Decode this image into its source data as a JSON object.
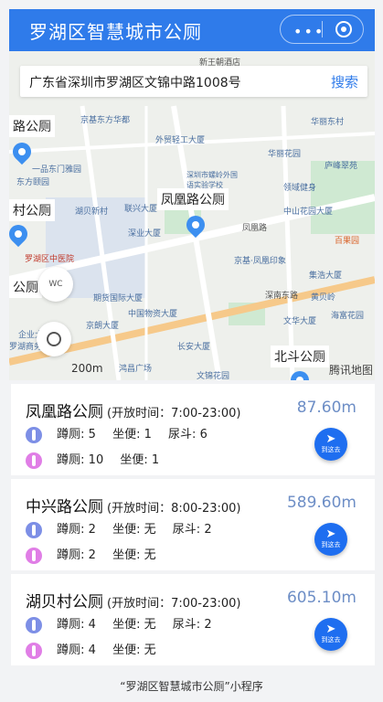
{
  "header": {
    "title": "罗湖区智慧城市公厕"
  },
  "search": {
    "value": "广东省深圳市罗湖区文锦中路1008号",
    "button": "搜索"
  },
  "map": {
    "callouts": [
      "路公厕",
      "凤凰路公厕",
      "村公厕",
      "公厕",
      "北斗公厕"
    ],
    "pois": [
      "新王朝酒店",
      "京基东方华都",
      "外贸轻工大厦",
      "华丽东村",
      "华丽花园",
      "庐峰翠苑",
      "一品东门雅园",
      "东方颐园",
      "深圳市螺岭外国语实验学校",
      "领域健身",
      "湖贝新村",
      "联兴大厦",
      "深业大厦",
      "中山花园大厦",
      "百果园",
      "罗湖区中医院",
      "京基·凤凰印象",
      "集浩大厦",
      "期货国际大厦",
      "中国物资大厦",
      "深南东路",
      "黄贝岭",
      "文华大厦",
      "海富花园",
      "京朗大厦",
      "长安大厦",
      "鸿昌广场",
      "文锦花园",
      "凤凰路",
      "企业大厦",
      "罗湖商务中心"
    ],
    "logo": "腾讯地图",
    "wc_label": "WC",
    "scale": "200m"
  },
  "go_button_label": "到这去",
  "labels": {
    "squat": "蹲厕:",
    "sit": "坐便:",
    "urinal": "尿斗:"
  },
  "toilets": [
    {
      "name": "凤凰路公厕",
      "hours": "(开放时间：7:00-23:00)",
      "distance": "87.60m",
      "male": {
        "squat": "5",
        "sit": "1",
        "urinal": "6"
      },
      "female": {
        "squat": "10",
        "sit": "1"
      }
    },
    {
      "name": "中兴路公厕",
      "hours": "(开放时间：8:00-23:00)",
      "distance": "589.60m",
      "male": {
        "squat": "2",
        "sit": "无",
        "urinal": "2"
      },
      "female": {
        "squat": "2",
        "sit": "无"
      }
    },
    {
      "name": "湖贝村公厕",
      "hours": "(开放时间：7:00-23:00)",
      "distance": "605.10m",
      "male": {
        "squat": "4",
        "sit": "无",
        "urinal": "2"
      },
      "female": {
        "squat": "4",
        "sit": "无"
      }
    }
  ],
  "footer": "“罗湖区智慧城市公厕”小程序"
}
